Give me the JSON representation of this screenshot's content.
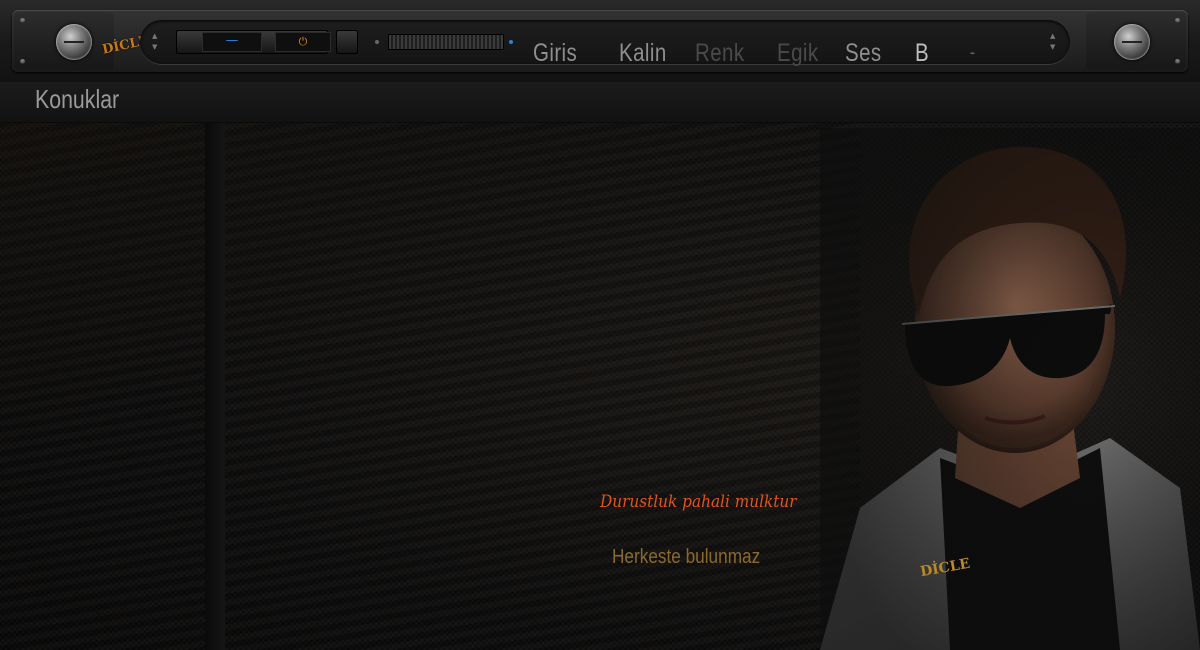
{
  "topbar": {
    "brand_left": "DİCLE",
    "menu": {
      "giris": "Giris",
      "kalin": "Kalin",
      "renk": "Renk",
      "egik": "Egik",
      "ses": "Ses",
      "b": "B",
      "dash": "-"
    },
    "player": {
      "minus_icon": "—",
      "power_icon": "⏻"
    }
  },
  "secondbar": {
    "title": "Konuklar"
  },
  "quote": {
    "line1": "Durustluk pahali mulktur",
    "line2": "Herkeste bulunmaz"
  },
  "portrait": {
    "badge": "DİCLE"
  },
  "colors": {
    "accent_orange": "#e2531a",
    "gold": "#8a6a2c",
    "blue": "#2f7fd6"
  }
}
